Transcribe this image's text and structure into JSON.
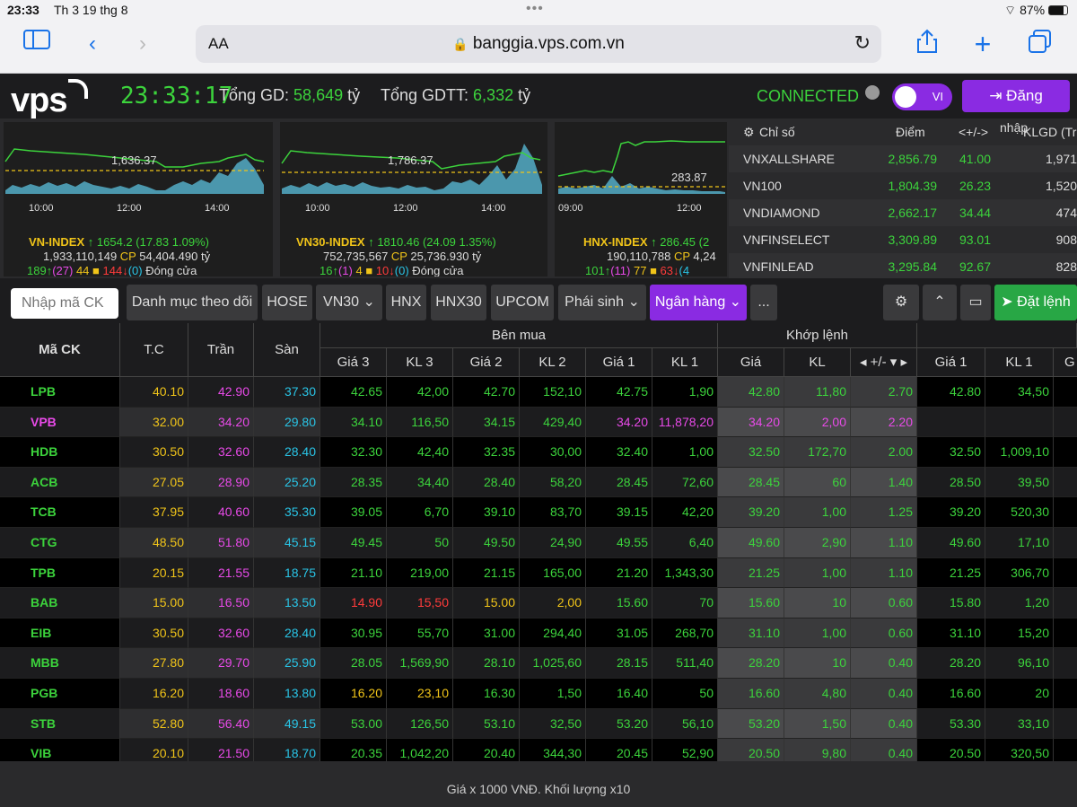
{
  "statusbar": {
    "time": "23:33",
    "date": "Th 3 19 thg 8",
    "battery": "87%"
  },
  "browser": {
    "aa": "AA",
    "url": "banggia.vps.com.vn"
  },
  "header": {
    "logo": "vps",
    "clock": "23:33:17",
    "tonggd_label": "Tổng GD:",
    "tonggd_value": "58,649",
    "tonggd_unit": "tỷ",
    "tonggdtt_label": "Tổng GDTT:",
    "tonggdtt_value": "6,332",
    "tonggdtt_unit": "tỷ",
    "status": "CONNECTED",
    "lang": "VI",
    "login": "Đăng"
  },
  "indices": [
    {
      "name": "VN-INDEX",
      "value": "1654.2",
      "change": "(17.83",
      "pct": "1.09%)",
      "volume": "1,933,110,149",
      "cp": "CP",
      "valtext": "54,404.490",
      "unit": "tỷ",
      "adv": "189",
      "ceil": "(27)",
      "ref": "44",
      "dec": "144",
      "floor": "(0)",
      "session": "Đóng cửa",
      "ref_label": "1,636.37",
      "t1": "10:00",
      "t2": "12:00",
      "t3": "14:00"
    },
    {
      "name": "VN30-INDEX",
      "value": "1810.46",
      "change": "(24.09",
      "pct": "1.35%)",
      "volume": "752,735,567",
      "cp": "CP",
      "valtext": "25,736.930",
      "unit": "tỷ",
      "adv": "16",
      "ceil": "(1)",
      "ref": "4",
      "dec": "10",
      "floor": "(0)",
      "session": "Đóng cửa",
      "ref_label": "1,786.37",
      "t1": "10:00",
      "t2": "12:00",
      "t3": "14:00"
    },
    {
      "name": "HNX-INDEX",
      "value": "286.45",
      "change": "(2",
      "pct": "",
      "volume": "190,110,788",
      "cp": "CP",
      "valtext": "4,24",
      "unit": "",
      "adv": "101",
      "ceil": "(11)",
      "ref": "77",
      "dec": "63",
      "floor": "(4",
      "session": "",
      "ref_label": "283.87",
      "t1": "09:00",
      "t2": "12:00",
      "t3": ""
    }
  ],
  "index_table": {
    "headers": [
      "Chỉ số",
      "Điểm",
      "<+/->",
      "nhập",
      "KLGD (Tr"
    ],
    "rows": [
      {
        "name": "VNXALLSHARE",
        "point": "2,856.79",
        "change": "41.00",
        "vol": "1,971"
      },
      {
        "name": "VN100",
        "point": "1,804.39",
        "change": "26.23",
        "vol": "1,520"
      },
      {
        "name": "VNDIAMOND",
        "point": "2,662.17",
        "change": "34.44",
        "vol": "474"
      },
      {
        "name": "VNFINSELECT",
        "point": "3,309.89",
        "change": "93.01",
        "vol": "908"
      },
      {
        "name": "VNFINLEAD",
        "point": "3,295.84",
        "change": "92.67",
        "vol": "828"
      }
    ]
  },
  "filters": {
    "search_placeholder": "Nhập mã CK",
    "watchlist": "Danh mục theo dõi",
    "hose": "HOSE",
    "vn30": "VN30",
    "hnx": "HNX",
    "hnx30": "HNX30",
    "upcom": "UPCOM",
    "derivatives": "Phái sinh",
    "banking": "Ngân hàng",
    "more": "...",
    "order": "Đặt lệnh"
  },
  "table": {
    "headers": {
      "symbol": "Mã CK",
      "ref": "T.C",
      "ceil": "Trần",
      "floor": "Sàn",
      "buy_group": "Bên mua",
      "match_group": "Khớp lệnh",
      "bid3": "Giá 3",
      "bvol3": "KL 3",
      "bid2": "Giá 2",
      "bvol2": "KL 2",
      "bid1": "Giá 1",
      "bvol1": "KL 1",
      "mprice": "Giá",
      "mvol": "KL",
      "mchange": "+/-",
      "ask1": "Giá 1",
      "avol1": "KL 1",
      "ask2": "G"
    },
    "rows": [
      {
        "s": "LPB",
        "sc": "up",
        "tc": "40.10",
        "tr": "42.90",
        "sa": "37.30",
        "g3": "42.65",
        "g3c": "up",
        "k3": "42,00",
        "g2": "42.70",
        "g2c": "up",
        "k2": "152,10",
        "g1": "42.75",
        "g1c": "up",
        "k1": "1,90",
        "mp": "42.80",
        "mc": "up",
        "mv": "11,80",
        "md": "2.70",
        "a1": "42.80",
        "a1c": "up",
        "av1": "34,50"
      },
      {
        "s": "VPB",
        "sc": "pink",
        "tc": "32.00",
        "tr": "34.20",
        "sa": "29.80",
        "g3": "34.10",
        "g3c": "up",
        "k3": "116,50",
        "g2": "34.15",
        "g2c": "up",
        "k2": "429,40",
        "g1": "34.20",
        "g1c": "pink",
        "k1": "11,878,20",
        "mp": "34.20",
        "mc": "pink",
        "mv": "2,00",
        "md": "2.20",
        "a1": "",
        "a1c": "up",
        "av1": ""
      },
      {
        "s": "HDB",
        "sc": "up",
        "tc": "30.50",
        "tr": "32.60",
        "sa": "28.40",
        "g3": "32.30",
        "g3c": "up",
        "k3": "42,40",
        "g2": "32.35",
        "g2c": "up",
        "k2": "30,00",
        "g1": "32.40",
        "g1c": "up",
        "k1": "1,00",
        "mp": "32.50",
        "mc": "up",
        "mv": "172,70",
        "md": "2.00",
        "a1": "32.50",
        "a1c": "up",
        "av1": "1,009,10"
      },
      {
        "s": "ACB",
        "sc": "up",
        "tc": "27.05",
        "tr": "28.90",
        "sa": "25.20",
        "g3": "28.35",
        "g3c": "up",
        "k3": "34,40",
        "g2": "28.40",
        "g2c": "up",
        "k2": "58,20",
        "g1": "28.45",
        "g1c": "up",
        "k1": "72,60",
        "mp": "28.45",
        "mc": "up",
        "mv": "60",
        "md": "1.40",
        "a1": "28.50",
        "a1c": "up",
        "av1": "39,50"
      },
      {
        "s": "TCB",
        "sc": "up",
        "tc": "37.95",
        "tr": "40.60",
        "sa": "35.30",
        "g3": "39.05",
        "g3c": "up",
        "k3": "6,70",
        "g2": "39.10",
        "g2c": "up",
        "k2": "83,70",
        "g1": "39.15",
        "g1c": "up",
        "k1": "42,20",
        "mp": "39.20",
        "mc": "up",
        "mv": "1,00",
        "md": "1.25",
        "a1": "39.20",
        "a1c": "up",
        "av1": "520,30"
      },
      {
        "s": "CTG",
        "sc": "up",
        "tc": "48.50",
        "tr": "51.80",
        "sa": "45.15",
        "g3": "49.45",
        "g3c": "up",
        "k3": "50",
        "g2": "49.50",
        "g2c": "up",
        "k2": "24,90",
        "g1": "49.55",
        "g1c": "up",
        "k1": "6,40",
        "mp": "49.60",
        "mc": "up",
        "mv": "2,90",
        "md": "1.10",
        "a1": "49.60",
        "a1c": "up",
        "av1": "17,10"
      },
      {
        "s": "TPB",
        "sc": "up",
        "tc": "20.15",
        "tr": "21.55",
        "sa": "18.75",
        "g3": "21.10",
        "g3c": "up",
        "k3": "219,00",
        "g2": "21.15",
        "g2c": "up",
        "k2": "165,00",
        "g1": "21.20",
        "g1c": "up",
        "k1": "1,343,30",
        "mp": "21.25",
        "mc": "up",
        "mv": "1,00",
        "md": "1.10",
        "a1": "21.25",
        "a1c": "up",
        "av1": "306,70"
      },
      {
        "s": "BAB",
        "sc": "up",
        "tc": "15.00",
        "tr": "16.50",
        "sa": "13.50",
        "g3": "14.90",
        "g3c": "down",
        "k3": "15,50",
        "g2": "15.00",
        "g2c": "ref",
        "k2": "2,00",
        "g1": "15.60",
        "g1c": "up",
        "k1": "70",
        "mp": "15.60",
        "mc": "up",
        "mv": "10",
        "md": "0.60",
        "a1": "15.80",
        "a1c": "up",
        "av1": "1,20"
      },
      {
        "s": "EIB",
        "sc": "up",
        "tc": "30.50",
        "tr": "32.60",
        "sa": "28.40",
        "g3": "30.95",
        "g3c": "up",
        "k3": "55,70",
        "g2": "31.00",
        "g2c": "up",
        "k2": "294,40",
        "g1": "31.05",
        "g1c": "up",
        "k1": "268,70",
        "mp": "31.10",
        "mc": "up",
        "mv": "1,00",
        "md": "0.60",
        "a1": "31.10",
        "a1c": "up",
        "av1": "15,20"
      },
      {
        "s": "MBB",
        "sc": "up",
        "tc": "27.80",
        "tr": "29.70",
        "sa": "25.90",
        "g3": "28.05",
        "g3c": "up",
        "k3": "1,569,90",
        "g2": "28.10",
        "g2c": "up",
        "k2": "1,025,60",
        "g1": "28.15",
        "g1c": "up",
        "k1": "511,40",
        "mp": "28.20",
        "mc": "up",
        "mv": "10",
        "md": "0.40",
        "a1": "28.20",
        "a1c": "up",
        "av1": "96,10"
      },
      {
        "s": "PGB",
        "sc": "up",
        "tc": "16.20",
        "tr": "18.60",
        "sa": "13.80",
        "g3": "16.20",
        "g3c": "ref",
        "k3": "23,10",
        "g2": "16.30",
        "g2c": "up",
        "k2": "1,50",
        "g1": "16.40",
        "g1c": "up",
        "k1": "50",
        "mp": "16.60",
        "mc": "up",
        "mv": "4,80",
        "md": "0.40",
        "a1": "16.60",
        "a1c": "up",
        "av1": "20"
      },
      {
        "s": "STB",
        "sc": "up",
        "tc": "52.80",
        "tr": "56.40",
        "sa": "49.15",
        "g3": "53.00",
        "g3c": "up",
        "k3": "126,50",
        "g2": "53.10",
        "g2c": "up",
        "k2": "32,50",
        "g1": "53.20",
        "g1c": "up",
        "k1": "56,10",
        "mp": "53.20",
        "mc": "up",
        "mv": "1,50",
        "md": "0.40",
        "a1": "53.30",
        "a1c": "up",
        "av1": "33,10"
      },
      {
        "s": "VIB",
        "sc": "up",
        "tc": "20.10",
        "tr": "21.50",
        "sa": "18.70",
        "g3": "20.35",
        "g3c": "up",
        "k3": "1,042,20",
        "g2": "20.40",
        "g2c": "up",
        "k2": "344,30",
        "g1": "20.45",
        "g1c": "up",
        "k1": "52,90",
        "mp": "20.50",
        "mc": "up",
        "mv": "9,80",
        "md": "0.40",
        "a1": "20.50",
        "a1c": "up",
        "av1": "320,50"
      }
    ]
  },
  "footer": "Giá x 1000 VNĐ. Khối lượng x10",
  "colors": {
    "up": "#3cd33c",
    "ref": "#f0c419",
    "down": "#ff3b3b",
    "ceil": "#e84ae8",
    "floor": "#29c4e6",
    "accent": "#8a2be2"
  }
}
